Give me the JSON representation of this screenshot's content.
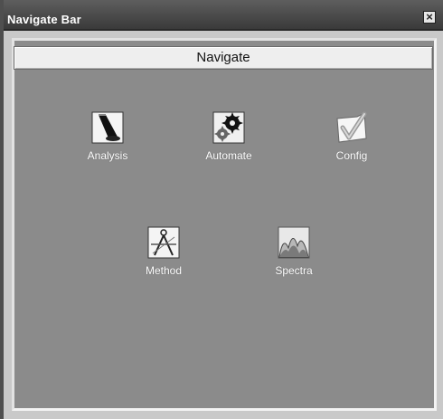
{
  "window": {
    "title": "Navigate Bar",
    "close_glyph": "⊠"
  },
  "header": {
    "label": "Navigate"
  },
  "nav_items": [
    {
      "id": "analysis",
      "label": "Analysis",
      "icon": "analysis-icon"
    },
    {
      "id": "automate",
      "label": "Automate",
      "icon": "automate-icon"
    },
    {
      "id": "config",
      "label": "Config",
      "icon": "config-icon"
    },
    {
      "id": "method",
      "label": "Method",
      "icon": "method-icon"
    },
    {
      "id": "spectra",
      "label": "Spectra",
      "icon": "spectra-icon"
    }
  ],
  "colors": {
    "title_bar": "#4a4a4a",
    "panel_background": "#8b8b8b",
    "label_text": "#ffffff"
  }
}
